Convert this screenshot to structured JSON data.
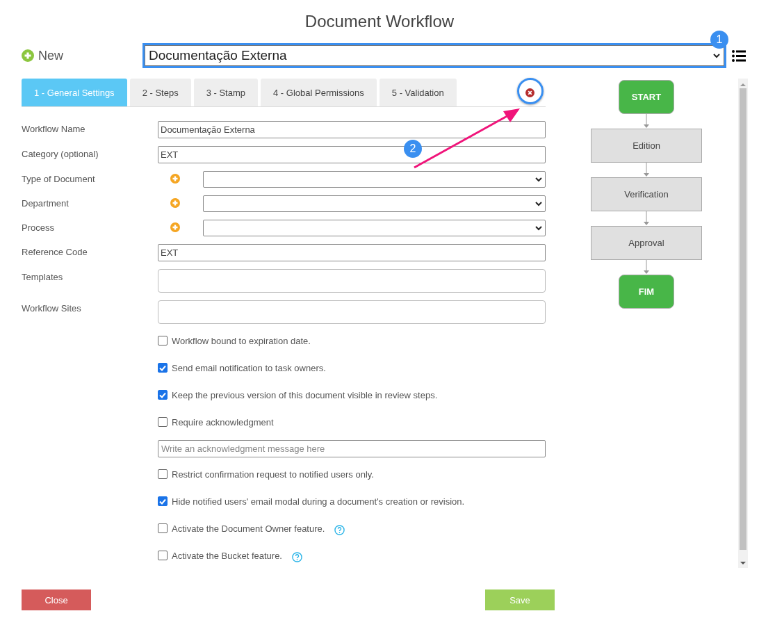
{
  "title": "Document Workflow",
  "new_button": {
    "label": "New"
  },
  "workflow_select": {
    "value": "Documentação Externa"
  },
  "tabs": [
    {
      "label": "1 - General Settings",
      "selected": true
    },
    {
      "label": "2 - Steps",
      "selected": false
    },
    {
      "label": "3 - Stamp",
      "selected": false
    },
    {
      "label": "4 - Global Permissions",
      "selected": false
    },
    {
      "label": "5 - Validation",
      "selected": false
    }
  ],
  "fields": [
    {
      "kind": "text",
      "label": "Workflow Name",
      "value": "Documentação Externa"
    },
    {
      "kind": "text",
      "label": "Category (optional)",
      "value": "EXT"
    },
    {
      "kind": "select",
      "label": "Type of Document"
    },
    {
      "kind": "select",
      "label": "Department"
    },
    {
      "kind": "select",
      "label": "Process"
    },
    {
      "kind": "text",
      "label": "Reference Code",
      "value": "EXT"
    },
    {
      "kind": "area",
      "label": "Templates"
    },
    {
      "kind": "area",
      "label": "Workflow Sites"
    }
  ],
  "options": [
    {
      "kind": "checkbox",
      "label": "Workflow bound to expiration date.",
      "checked": false
    },
    {
      "kind": "checkbox",
      "label": "Send email notification to task owners.",
      "checked": true
    },
    {
      "kind": "checkbox",
      "label": "Keep the previous version of this document visible in review steps.",
      "checked": true
    },
    {
      "kind": "checkbox",
      "label": "Require acknowledgment",
      "checked": false
    },
    {
      "kind": "input",
      "placeholder": "Write an acknowledgment message here"
    },
    {
      "kind": "checkbox",
      "label": "Restrict confirmation request to notified users only.",
      "checked": false
    },
    {
      "kind": "checkbox",
      "label": "Hide notified users' email modal during a document's creation or revision.",
      "checked": true
    },
    {
      "kind": "checkbox",
      "label": "Activate the Document Owner feature.",
      "checked": false,
      "help": true
    },
    {
      "kind": "checkbox",
      "label": "Activate the Bucket feature.",
      "checked": false,
      "help": true
    }
  ],
  "flow": [
    {
      "kind": "terminal",
      "label": "START"
    },
    {
      "kind": "step",
      "label": "Edition"
    },
    {
      "kind": "step",
      "label": "Verification"
    },
    {
      "kind": "step",
      "label": "Approval"
    },
    {
      "kind": "terminal",
      "label": "FIM"
    }
  ],
  "buttons": [
    {
      "kind": "close",
      "label": "Close"
    },
    {
      "kind": "save",
      "label": "Save"
    }
  ],
  "annotations": [
    {
      "label": "1"
    },
    {
      "label": "2"
    }
  ]
}
